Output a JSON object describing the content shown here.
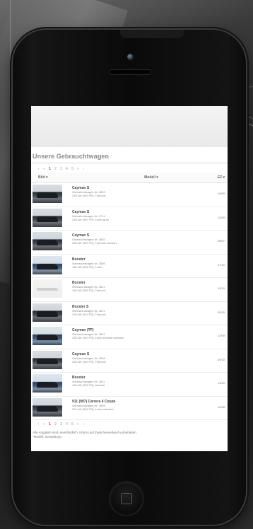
{
  "page": {
    "title": "Unsere Gebrauchtwagen",
    "footnote": "Alle Angaben sind unverbindlich. Irrtum und Zwischenverkauf vorbehalten.",
    "footnote2": "*Modell: ausstattung"
  },
  "pagination": {
    "pages": [
      "‹",
      "«",
      "1",
      "2",
      "3",
      "4",
      "5",
      "»",
      "›"
    ],
    "active_index": 2
  },
  "table": {
    "headers": {
      "bild": "Bild",
      "modell": "Modell",
      "ez": "EZ"
    }
  },
  "cars": [
    {
      "name": "Cayman S",
      "line1": "Gebrauchtwagen Nr. 2803",
      "line2": "235 kW (320 PS), Tiptronic",
      "ez": "10/09",
      "thumb": "dark"
    },
    {
      "name": "Cayman S",
      "line1": "Gebrauchtwagen Nr. 2714",
      "line2": "235 kW (320 PS), Leder grau",
      "ez": "12/09",
      "thumb": "dark"
    },
    {
      "name": "Cayman S",
      "line1": "Gebrauchtwagen Nr. 2802",
      "line2": "235 kW (320 PS), Tiptronic schwarz",
      "ez": "08/07",
      "thumb": "dark"
    },
    {
      "name": "Boxster",
      "line1": "Gebrauchtwagen Nr. 2806",
      "line2": "188 kW (255 PS), Leder",
      "ez": "07/10",
      "thumb": "blue"
    },
    {
      "name": "Boxster",
      "line1": "Gebrauchtwagen Nr. 2821",
      "line2": "188 kW (255 PS), Tiptronic",
      "ez": "12/10",
      "thumb": "light"
    },
    {
      "name": "Boxster S",
      "line1": "Gebrauchtwagen Nr. 2874",
      "line2": "228 kW (310 PS), Tiptronic",
      "ez": "05/10",
      "thumb": "dark"
    },
    {
      "name": "Cayman (TP)",
      "line1": "Gebrauchtwagen Nr. 2821",
      "line2": "235 kW (320 PS), Leder Antrazit schwarz",
      "ez": "11/09",
      "thumb": "blue"
    },
    {
      "name": "Cayman S",
      "line1": "Gebrauchtwagen Nr. 2808",
      "line2": "235 kW (320 PS), Tiptronic",
      "ez": "09/10",
      "thumb": "dark"
    },
    {
      "name": "Boxster",
      "line1": "Gebrauchtwagen Nr. 2811",
      "line2": "188 kW (255 PS), Antrazit",
      "ez": "11/09",
      "thumb": "blue"
    },
    {
      "name": "911 (997) Carrera 4 Coupé",
      "line1": "Gebrauchtwagen Nr. 2809",
      "line2": "254 kW (345 PS), Leder schwarz",
      "ez": "10/08",
      "thumb": "dark"
    }
  ]
}
